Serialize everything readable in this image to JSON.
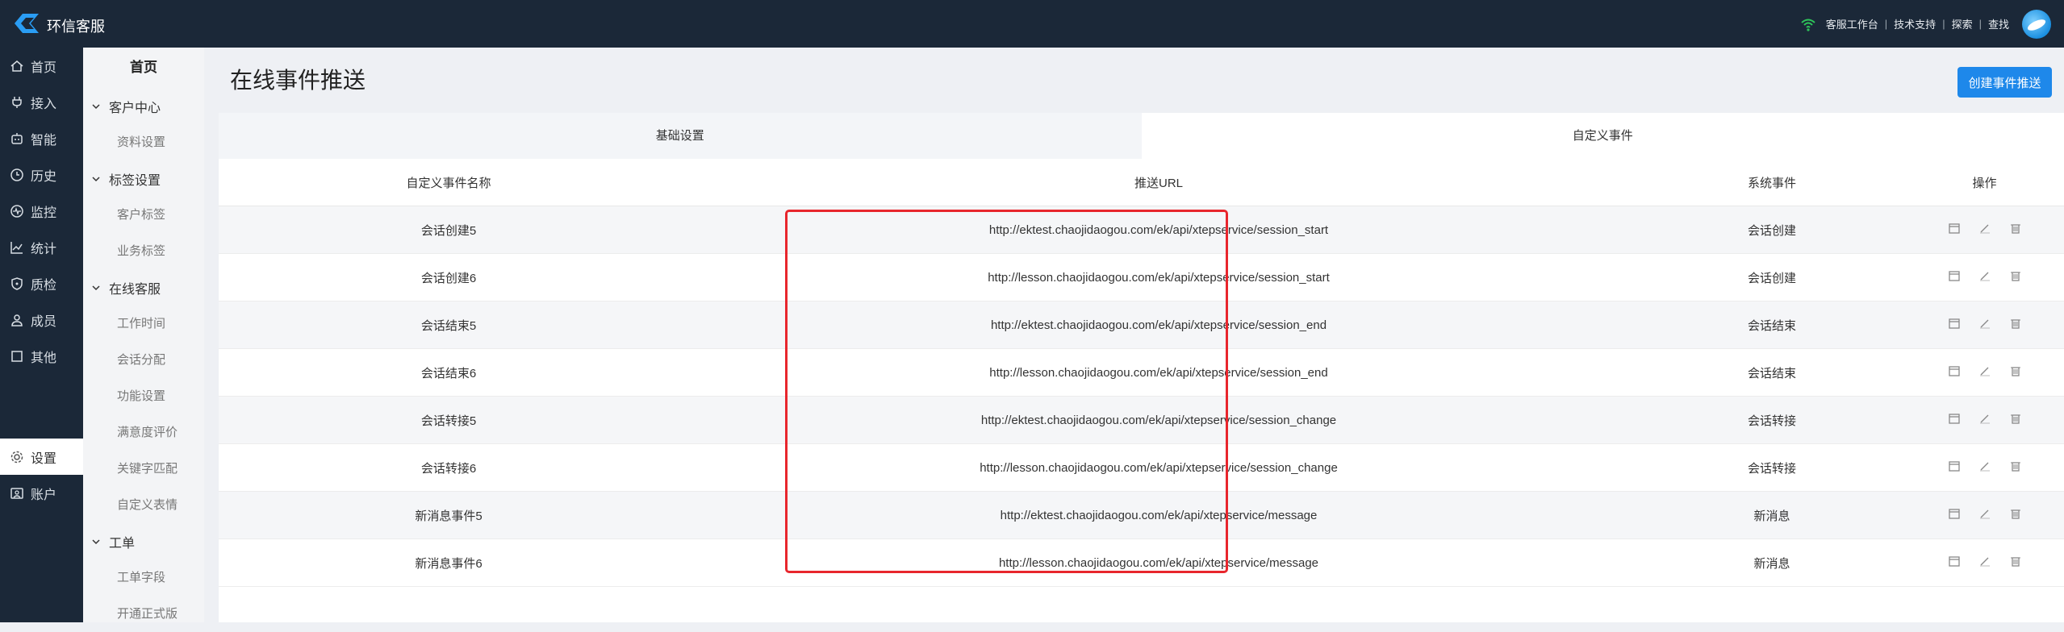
{
  "app": {
    "title": "环信客服"
  },
  "header_links": [
    "客服工作台",
    "技术支持",
    "探索",
    "查找"
  ],
  "colors": {
    "accent": "#1e88ea",
    "nav_bg": "#1b2838",
    "highlight": "#e8262d"
  },
  "nav": {
    "items": [
      {
        "label": "首页",
        "icon": "home-icon"
      },
      {
        "label": "接入",
        "icon": "plug-icon"
      },
      {
        "label": "智能",
        "icon": "robot-icon"
      },
      {
        "label": "历史",
        "icon": "clock-icon"
      },
      {
        "label": "监控",
        "icon": "monitor-icon"
      },
      {
        "label": "统计",
        "icon": "chart-icon"
      },
      {
        "label": "质检",
        "icon": "shield-icon"
      },
      {
        "label": "成员",
        "icon": "users-icon"
      },
      {
        "label": "其他",
        "icon": "square-icon"
      }
    ],
    "bottom_items": [
      {
        "label": "设置",
        "icon": "gear-icon",
        "active": true
      },
      {
        "label": "账户",
        "icon": "account-icon"
      }
    ]
  },
  "subnav": {
    "title": "首页",
    "sections": [
      {
        "label": "客户中心",
        "items": [
          "资料设置"
        ]
      },
      {
        "label": "标签设置",
        "items": [
          "客户标签",
          "业务标签"
        ]
      },
      {
        "label": "在线客服",
        "items": [
          "工作时间",
          "会话分配",
          "功能设置",
          "满意度评价",
          "关键字匹配",
          "自定义表情"
        ]
      },
      {
        "label": "工单",
        "items": [
          "工单字段",
          "开通正式版"
        ]
      }
    ]
  },
  "main": {
    "title": "在线事件推送",
    "create_button": "创建事件推送",
    "tabs": [
      {
        "label": "基础设置",
        "active": false
      },
      {
        "label": "自定义事件",
        "active": true
      }
    ],
    "table": {
      "headers": [
        "自定义事件名称",
        "推送URL",
        "系统事件",
        "操作"
      ],
      "rows": [
        {
          "name": "会话创建5",
          "url": "http://ektest.chaojidaogou.com/ek/api/xtepservice/session_start",
          "event": "会话创建"
        },
        {
          "name": "会话创建6",
          "url": "http://lesson.chaojidaogou.com/ek/api/xtepservice/session_start",
          "event": "会话创建"
        },
        {
          "name": "会话结束5",
          "url": "http://ektest.chaojidaogou.com/ek/api/xtepservice/session_end",
          "event": "会话结束"
        },
        {
          "name": "会话结束6",
          "url": "http://lesson.chaojidaogou.com/ek/api/xtepservice/session_end",
          "event": "会话结束"
        },
        {
          "name": "会话转接5",
          "url": "http://ektest.chaojidaogou.com/ek/api/xtepservice/session_change",
          "event": "会话转接"
        },
        {
          "name": "会话转接6",
          "url": "http://lesson.chaojidaogou.com/ek/api/xtepservice/session_change",
          "event": "会话转接"
        },
        {
          "name": "新消息事件5",
          "url": "http://ektest.chaojidaogou.com/ek/api/xtepservice/message",
          "event": "新消息"
        },
        {
          "name": "新消息事件6",
          "url": "http://lesson.chaojidaogou.com/ek/api/xtepservice/message",
          "event": "新消息"
        }
      ],
      "row_actions": [
        "calendar-icon",
        "edit-icon",
        "delete-icon"
      ]
    }
  }
}
